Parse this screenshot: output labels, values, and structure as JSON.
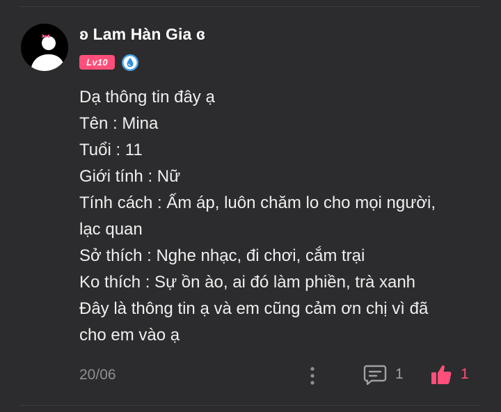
{
  "comment": {
    "author": {
      "username": "ʚ Lam Hàn Gia ɞ",
      "level_badge": "Lv10",
      "avatar_icon": "default-avatar-with-bow",
      "member_icon": "water-drop-badge"
    },
    "body_lines": [
      "Dạ thông tin đây ạ",
      "Tên : Mina",
      "Tuổi : 11",
      "Giới tính : Nữ",
      "Tính cách : Ấm áp, luôn chăm lo cho mọi người,",
      "lạc quan",
      "Sở thích : Nghe nhạc, đi chơi, cắm trại",
      "Ko thích : Sự ồn ào, ai đó làm phiền, trà xanh",
      "Đây là thông tin ạ và em cũng cảm ơn chị vì đã",
      "cho em vào ạ"
    ],
    "footer": {
      "date": "20/06",
      "more_icon": "more-vertical-icon",
      "comment_icon": "comment-icon",
      "comment_count": "1",
      "like_icon": "thumbs-up-icon",
      "like_count": "1"
    }
  },
  "colors": {
    "background": "#2c2c2e",
    "accent_pink": "#ff4f7a",
    "muted_text": "#8e8e93",
    "body_text": "#efefef"
  }
}
